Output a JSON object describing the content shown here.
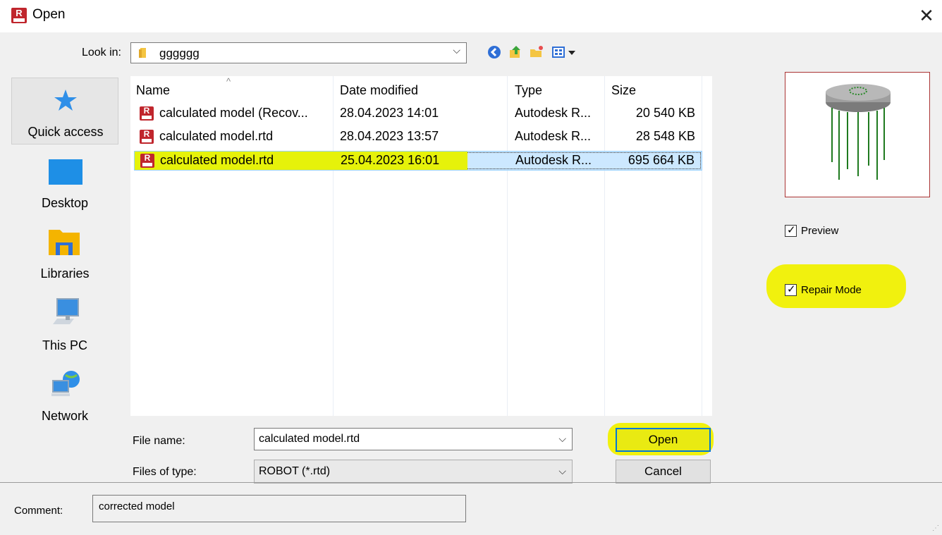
{
  "window": {
    "title": "Open",
    "close_glyph": "✕"
  },
  "look_in": {
    "label": "Look in:",
    "value": "gggggg",
    "arrow": "⌵"
  },
  "places": [
    {
      "label": "Quick access",
      "icon": "star-icon"
    },
    {
      "label": "Desktop",
      "icon": "desktop-icon"
    },
    {
      "label": "Libraries",
      "icon": "libraries-icon"
    },
    {
      "label": "This PC",
      "icon": "computer-icon"
    },
    {
      "label": "Network",
      "icon": "network-icon"
    }
  ],
  "file_list": {
    "columns": [
      "Name",
      "Date modified",
      "Type",
      "Size"
    ],
    "rows": [
      {
        "name": "calculated model (Recov...",
        "date": "28.04.2023 14:01",
        "type": "Autodesk R...",
        "size": "20 540 KB",
        "selected": false
      },
      {
        "name": "calculated model.rtd",
        "date": "28.04.2023 13:57",
        "type": "Autodesk R...",
        "size": "28 548 KB",
        "selected": false
      },
      {
        "name": "calculated  model.rtd",
        "date": "25.04.2023 16:01",
        "type": "Autodesk R...",
        "size": "695 664 KB",
        "selected": true
      }
    ]
  },
  "file_name": {
    "label": "File name:",
    "value": "calculated  model.rtd"
  },
  "file_type": {
    "label": "Files of type:",
    "value": "ROBOT (*.rtd)"
  },
  "buttons": {
    "open": "Open",
    "cancel": "Cancel"
  },
  "options": {
    "preview": {
      "label": "Preview",
      "checked": true
    },
    "repair_mode": {
      "label": "Repair Mode",
      "checked": true
    }
  },
  "comment": {
    "label": "Comment:",
    "value": "corrected model"
  },
  "colors": {
    "highlight": "#e6f20a",
    "selection": "#cce8ff",
    "brand": "#c0262d",
    "focus": "#0078d7"
  }
}
